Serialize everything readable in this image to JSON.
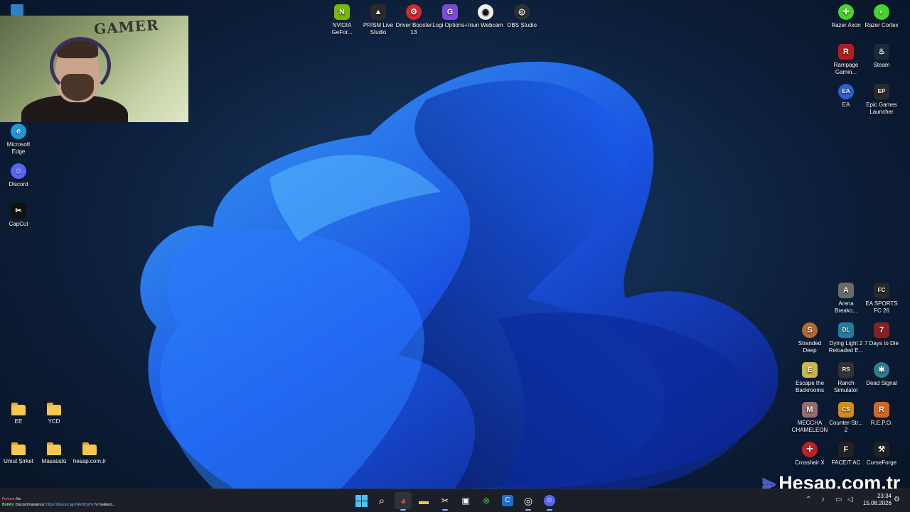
{
  "overlay": {
    "webcam_tag": "GAMER"
  },
  "desktop": {
    "top_icons": [
      {
        "label": "NVIDIA GeFor...",
        "icon": "nvidia-icon",
        "color": "#76b900",
        "glyph": "N"
      },
      {
        "label": "PRISM Live Studio",
        "icon": "prism-icon",
        "color": "#2a2a2a",
        "glyph": "▲"
      },
      {
        "label": "Driver Booster 13",
        "icon": "driver-booster-icon",
        "color": "#d42a2a",
        "glyph": "⚙"
      },
      {
        "label": "Logi Options+",
        "icon": "logi-icon",
        "color": "#7b4bd8",
        "glyph": "G"
      },
      {
        "label": "Iriun Webcam",
        "icon": "iriun-icon",
        "color": "#f0f0f0",
        "glyph": "◉"
      },
      {
        "label": "OBS Studio",
        "icon": "obs-icon",
        "color": "#303030",
        "glyph": "◎"
      }
    ],
    "left_icons": [
      {
        "label": "Microsoft Edge",
        "icon": "edge-icon",
        "color": "#1d9bd9",
        "glyph": "e"
      },
      {
        "label": "Discord",
        "icon": "discord-icon",
        "color": "#5865f2",
        "glyph": "☺"
      },
      {
        "label": "CapCut",
        "icon": "capcut-icon",
        "color": "#111111",
        "glyph": "✂"
      }
    ],
    "folders": [
      {
        "label": "EE"
      },
      {
        "label": "YCD"
      },
      {
        "label": "Umut Şirket"
      },
      {
        "label": "Masaüstü"
      },
      {
        "label": "hesap.com.tr"
      }
    ],
    "right_icons": [
      {
        "label": "Razer Axon",
        "icon": "razer-axon-icon",
        "color": "#44d62c",
        "glyph": "✚"
      },
      {
        "label": "Razer Cortex",
        "icon": "razer-cortex-icon",
        "color": "#44d62c",
        "glyph": "◐"
      },
      {
        "label": "Rampage Gamin...",
        "icon": "rampage-icon",
        "color": "#b51d1d",
        "glyph": "R"
      },
      {
        "label": "Steam",
        "icon": "steam-icon",
        "color": "#1b2838",
        "glyph": "♨"
      },
      {
        "label": "EA",
        "icon": "ea-icon",
        "color": "#2d5fd6",
        "glyph": "EA"
      },
      {
        "label": "Epic Games Launcher",
        "icon": "epic-icon",
        "color": "#2a2a2a",
        "glyph": "EP"
      },
      {
        "label": "Arena Breako...",
        "icon": "arena-icon",
        "color": "#6a6a6a",
        "glyph": "A"
      },
      {
        "label": "EA SPORTS FC 26",
        "icon": "fc26-icon",
        "color": "#2a2a2a",
        "glyph": "FC"
      },
      {
        "label": "Stranded Deep",
        "icon": "stranded-icon",
        "color": "#b36a2c",
        "glyph": "S"
      },
      {
        "label": "Dying Light 2 Reloaded E...",
        "icon": "dying-light-icon",
        "color": "#1e7da0",
        "glyph": "DL"
      },
      {
        "label": "7 Days to Die",
        "icon": "7days-icon",
        "color": "#8a2020",
        "glyph": "7"
      },
      {
        "label": "Escape the Backrooms",
        "icon": "backrooms-icon",
        "color": "#c9b54a",
        "glyph": "E"
      },
      {
        "label": "Ranch Simulator",
        "icon": "ranch-icon",
        "color": "#333333",
        "glyph": "RS"
      },
      {
        "label": "Dead Signal",
        "icon": "dead-signal-icon",
        "color": "#2a8090",
        "glyph": "✱"
      },
      {
        "label": "MECCHA CHAMELEON",
        "icon": "meccha-icon",
        "color": "#9a6a6a",
        "glyph": "M"
      },
      {
        "label": "Counter-Str... 2",
        "icon": "cs2-icon",
        "color": "#d48a1a",
        "glyph": "CS"
      },
      {
        "label": "R.E.P.O.",
        "icon": "repo-icon",
        "color": "#d8661a",
        "glyph": "R"
      },
      {
        "label": "Crosshair X",
        "icon": "crosshair-icon",
        "color": "#c02020",
        "glyph": "✛"
      },
      {
        "label": "FACEIT AC",
        "icon": "faceit-icon",
        "color": "#222222",
        "glyph": "F"
      },
      {
        "label": "CurseForge",
        "icon": "curseforge-icon",
        "color": "#222222",
        "glyph": "⚒"
      }
    ]
  },
  "chat": {
    "line1_user": "Funnze",
    "line1_text": ": lkc",
    "line2_user": "BotRix",
    "line2_text": ": Discord Kanalımız:",
    "line2_link": "https://discord.gg/vWkWDsHv7W",
    "line2_tail": " bekleriz..."
  },
  "watermark": {
    "text": "Hesap.com.tr"
  },
  "taskbar": {
    "apps": [
      {
        "name": "start-button",
        "icon": "windows-start-icon",
        "color": "#4cc2ff",
        "glyph": ""
      },
      {
        "name": "search-button",
        "icon": "search-icon",
        "color": "transparent",
        "glyph": "⌕"
      },
      {
        "name": "chrome-button",
        "icon": "chrome-icon",
        "color": "#3c4043",
        "glyph": "◕"
      },
      {
        "name": "explorer-button",
        "icon": "folder-icon",
        "color": "transparent",
        "glyph": "▬"
      },
      {
        "name": "capcut-taskbar-button",
        "icon": "capcut-icon",
        "color": "#111111",
        "glyph": "✂"
      },
      {
        "name": "capture-button",
        "icon": "capture-icon",
        "color": "transparent",
        "glyph": "▣"
      },
      {
        "name": "xbox-button",
        "icon": "xbox-icon",
        "color": "transparent",
        "glyph": "⊗"
      },
      {
        "name": "app-c-button",
        "icon": "app-c-icon",
        "color": "#1d6fd8",
        "glyph": "C"
      },
      {
        "name": "obs-taskbar-button",
        "icon": "obs-icon",
        "color": "transparent",
        "glyph": "◎"
      },
      {
        "name": "discord-taskbar-button",
        "icon": "discord-icon",
        "color": "#5865f2",
        "glyph": "☺"
      }
    ],
    "time": "23:34",
    "date": "15.08.2026"
  }
}
